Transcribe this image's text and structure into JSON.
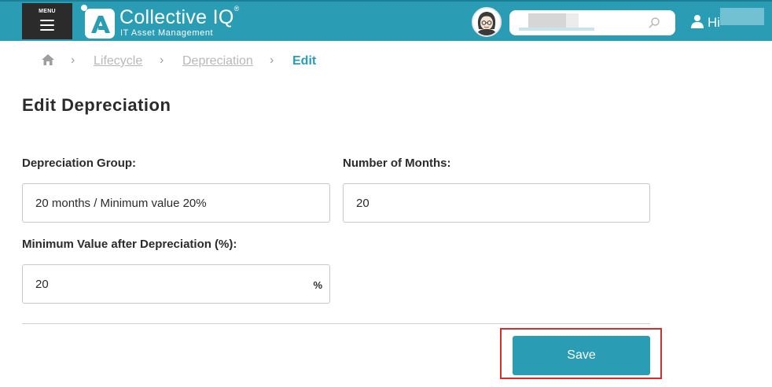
{
  "header": {
    "menu_label": "MENU",
    "brand_name": "Collective IQ",
    "brand_reg": "®",
    "brand_tagline": "IT Asset Management",
    "greeting": "Hi"
  },
  "breadcrumb": {
    "items": [
      {
        "label": "Lifecycle"
      },
      {
        "label": "Depreciation"
      },
      {
        "label": "Edit"
      }
    ]
  },
  "page": {
    "title": "Edit Depreciation"
  },
  "form": {
    "group_label": "Depreciation Group:",
    "group_value": "20 months / Minimum value 20%",
    "months_label": "Number of Months:",
    "months_value": "20",
    "minvalue_label": "Minimum Value after Depreciation (%):",
    "minvalue_value": "20",
    "minvalue_suffix": "%"
  },
  "actions": {
    "save_label": "Save"
  },
  "colors": {
    "header": "#2a9cb4",
    "menu": "#2b2b2b",
    "accent": "#2a9cb4",
    "highlight": "#d32f2f"
  }
}
